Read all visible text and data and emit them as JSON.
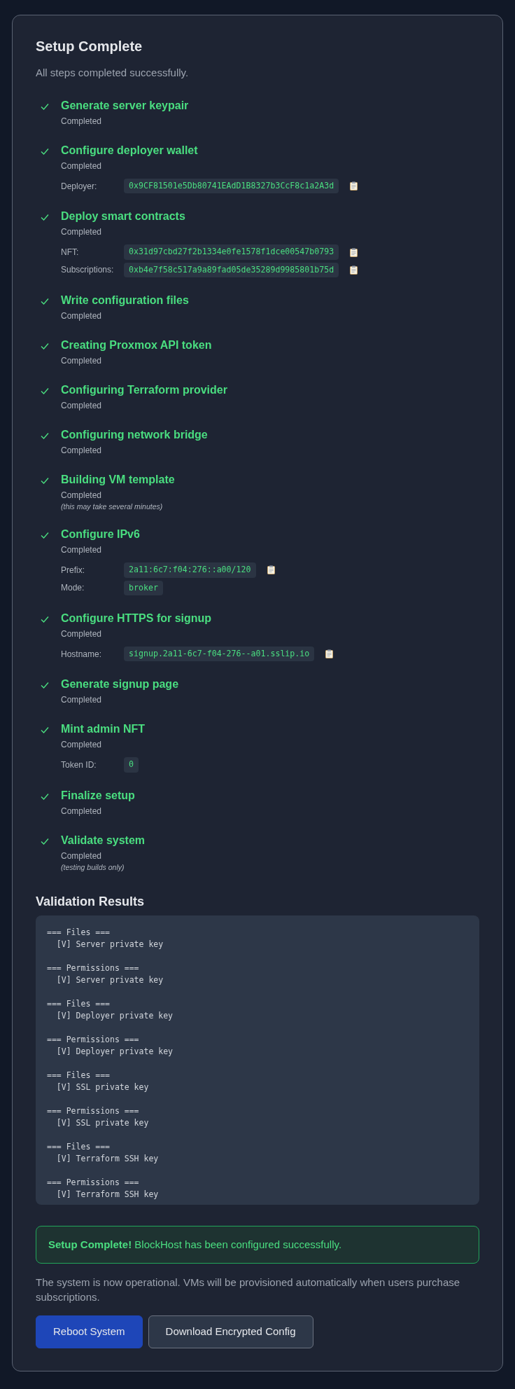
{
  "title": "Setup Complete",
  "subtitle": "All steps completed successfully.",
  "steps": [
    {
      "title": "Generate server keypair",
      "status": "Completed",
      "completed": true
    },
    {
      "title": "Configure deployer wallet",
      "status": "Completed",
      "completed": true,
      "details": [
        {
          "label": "Deployer:",
          "value": "0x9CF81501e5Db80741EAdD1B8327b3CcF8c1a2A3d",
          "copyable": true
        }
      ]
    },
    {
      "title": "Deploy smart contracts",
      "status": "Completed",
      "completed": true,
      "details": [
        {
          "label": "NFT:",
          "value": "0x31d97cbd27f2b1334e0fe1578f1dce00547b0793",
          "copyable": true
        },
        {
          "label": "Subscriptions:",
          "value": "0xb4e7f58c517a9a89fad05de35289d9985801b75d",
          "copyable": true
        }
      ]
    },
    {
      "title": "Write configuration files",
      "status": "Completed",
      "completed": true
    },
    {
      "title": "Creating Proxmox API token",
      "status": "Completed",
      "completed": true
    },
    {
      "title": "Configuring Terraform provider",
      "status": "Completed",
      "completed": true
    },
    {
      "title": "Configuring network bridge",
      "status": "Completed",
      "completed": true
    },
    {
      "title": "Building VM template",
      "status": "Completed",
      "completed": true,
      "note": "(this may take several minutes)"
    },
    {
      "title": "Configure IPv6",
      "status": "Completed",
      "completed": true,
      "details": [
        {
          "label": "Prefix:",
          "value": "2a11:6c7:f04:276::a00/120",
          "copyable": true
        },
        {
          "label": "Mode:",
          "value": "broker",
          "copyable": false
        }
      ]
    },
    {
      "title": "Configure HTTPS for signup",
      "status": "Completed",
      "completed": true,
      "details": [
        {
          "label": "Hostname:",
          "value": "signup.2a11-6c7-f04-276--a01.sslip.io",
          "copyable": true
        }
      ]
    },
    {
      "title": "Generate signup page",
      "status": "Completed",
      "completed": true
    },
    {
      "title": "Mint admin NFT",
      "status": "Completed",
      "completed": true,
      "details": [
        {
          "label": "Token ID:",
          "value": "0",
          "copyable": false
        }
      ]
    },
    {
      "title": "Finalize setup",
      "status": "Completed",
      "completed": true
    },
    {
      "title": "Validate system",
      "status": "Completed",
      "completed": true,
      "note": "(testing builds only)"
    }
  ],
  "validation": {
    "title": "Validation Results",
    "output": "=== Files ===\n  [V] Server private key\n\n=== Permissions ===\n  [V] Server private key\n\n=== Files ===\n  [V] Deployer private key\n\n=== Permissions ===\n  [V] Deployer private key\n\n=== Files ===\n  [V] SSL private key\n\n=== Permissions ===\n  [V] SSL private key\n\n=== Files ===\n  [V] Terraform SSH key\n\n=== Permissions ===\n  [V] Terraform SSH key"
  },
  "banner": "**Setup Complete!** BlockHost has been configured successfully.",
  "message": "The system is now operational. VMs will be provisioned automatically when users purchase subscriptions.",
  "buttons": [
    {
      "label": "Reboot System",
      "kind": "primary"
    },
    {
      "label": "Download Encrypted Config",
      "kind": "secondary"
    }
  ]
}
